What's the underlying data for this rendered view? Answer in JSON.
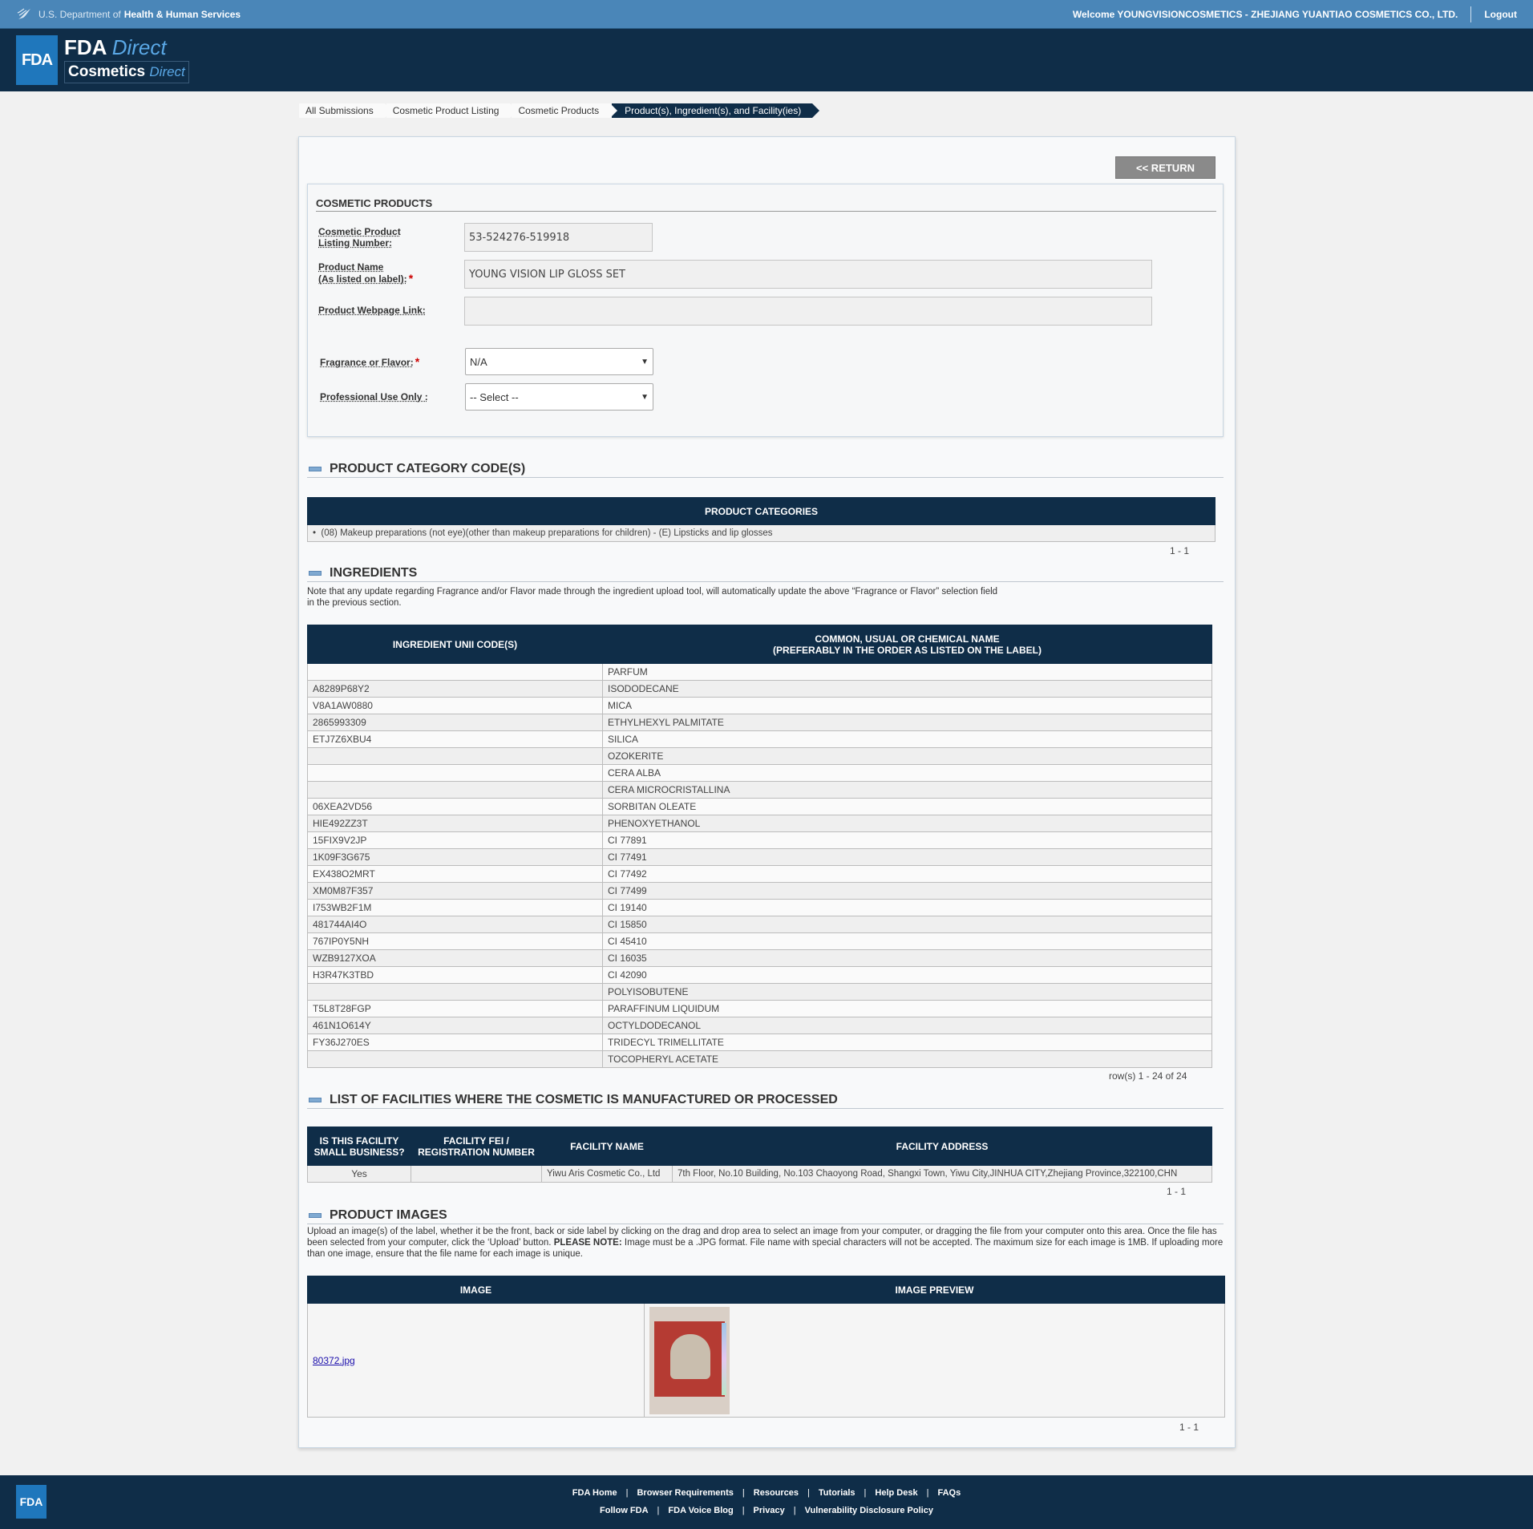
{
  "topbar": {
    "dept_prefix": "U.S. Department of",
    "dept_name": "Health & Human Services",
    "welcome": "Welcome YOUNGVISIONCOSMETICS - ZHEJIANG YUANTIAO COSMETICS CO., LTD.",
    "logout": "Logout"
  },
  "header": {
    "badge": "FDA",
    "brand_bold": "FDA",
    "brand_italic": "Direct",
    "brand2_bold": "Cosmetics",
    "brand2_italic": "Direct"
  },
  "breadcrumb": [
    "All Submissions",
    "Cosmetic Product Listing",
    "Cosmetic Products",
    "Product(s), Ingredient(s), and Facility(ies)"
  ],
  "return_button": "<< RETURN",
  "cosmetic_products": {
    "title": "COSMETIC PRODUCTS",
    "listing_number_label_1": "Cosmetic Product",
    "listing_number_label_2": "Listing Number:",
    "listing_number": "53-524276-519918",
    "product_name_label_1": "Product Name",
    "product_name_label_2": "(As listed on label):",
    "product_name": "YOUNG VISION LIP GLOSS SET",
    "webpage_label": "Product Webpage Link:",
    "webpage_value": "",
    "fragrance_label": "Fragrance or Flavor:",
    "fragrance_value": "N/A",
    "professional_label": "Professional Use Only :",
    "professional_value": "-- Select --",
    "required_mark": "*"
  },
  "category_section": {
    "title": "PRODUCT CATEGORY CODE(S)",
    "column": "PRODUCT CATEGORIES",
    "items": [
      "(08) Makeup preparations (not eye)(other than makeup preparations for children) - (E) Lipsticks and lip glosses"
    ],
    "pager": "1 - 1"
  },
  "ingredients_section": {
    "title": "INGREDIENTS",
    "note_1": "Note that any update regarding Fragrance and/or Flavor made through the ingredient upload tool, will automatically update the above “Fragrance or Flavor” selection field",
    "note_2": "in the previous section.",
    "col1": "INGREDIENT UNII CODE(S)",
    "col2_line1": "COMMON, USUAL OR CHEMICAL NAME",
    "col2_line2": "(PREFERABLY IN THE ORDER AS LISTED ON THE LABEL)",
    "rows": [
      [
        "",
        "PARFUM"
      ],
      [
        "A8289P68Y2",
        "ISODODECANE"
      ],
      [
        "V8A1AW0880",
        "MICA"
      ],
      [
        "2865993309",
        "ETHYLHEXYL PALMITATE"
      ],
      [
        "ETJ7Z6XBU4",
        "SILICA"
      ],
      [
        "",
        "OZOKERITE"
      ],
      [
        "",
        "CERA ALBA"
      ],
      [
        "",
        "CERA MICROCRISTALLINA"
      ],
      [
        "06XEA2VD56",
        "SORBITAN OLEATE"
      ],
      [
        "HIE492ZZ3T",
        "PHENOXYETHANOL"
      ],
      [
        "15FIX9V2JP",
        "CI 77891"
      ],
      [
        "1K09F3G675",
        "CI 77491"
      ],
      [
        "EX438O2MRT",
        "CI 77492"
      ],
      [
        "XM0M87F357",
        "CI 77499"
      ],
      [
        "I753WB2F1M",
        "CI 19140"
      ],
      [
        "481744AI4O",
        "CI 15850"
      ],
      [
        "767IP0Y5NH",
        "CI 45410"
      ],
      [
        "WZB9127XOA",
        "CI 16035"
      ],
      [
        "H3R47K3TBD",
        "CI 42090"
      ],
      [
        "",
        "POLYISOBUTENE"
      ],
      [
        "T5L8T28FGP",
        "PARAFFINUM LIQUIDUM"
      ],
      [
        "461N1O614Y",
        "OCTYLDODECANOL"
      ],
      [
        "FY36J270ES",
        "TRIDECYL TRIMELLITATE"
      ],
      [
        "",
        "TOCOPHERYL ACETATE"
      ]
    ],
    "pager": "row(s) 1 - 24 of 24"
  },
  "facilities_section": {
    "title": "LIST OF FACILITIES WHERE THE COSMETIC IS MANUFACTURED OR PROCESSED",
    "col1_line1": "IS THIS FACILITY",
    "col1_line2": "SMALL BUSINESS?",
    "col2_line1": "FACILITY FEI /",
    "col2_line2": "REGISTRATION NUMBER",
    "col3": "FACILITY NAME",
    "col4": "FACILITY ADDRESS",
    "rows": [
      [
        "Yes",
        "",
        "Yiwu Aris Cosmetic Co., Ltd",
        "7th Floor, No.10 Building, No.103 Chaoyong Road, Shangxi Town, Yiwu City,JINHUA CITY,Zhejiang Province,322100,CHN"
      ]
    ],
    "pager": "1 - 1"
  },
  "images_section": {
    "title": "PRODUCT IMAGES",
    "note_a": "Upload an image(s) of the label, whether it be the front, back or side label by clicking on the drag and drop area to select an image from your computer, or dragging the file from your computer onto this area. Once the file has been selected from your computer, click the ‘Upload’ button.",
    "note_strong": "PLEASE NOTE:",
    "note_b": "Image must be a .JPG format. File name with special characters will not be accepted. The maximum size for each image is 1MB. If uploading more than one image, ensure that the file name for each image is unique.",
    "col1": "IMAGE",
    "col2": "IMAGE PREVIEW",
    "file_name": "80372.jpg",
    "pager": "1 - 1"
  },
  "footer": {
    "badge": "FDA",
    "row1": [
      "FDA Home",
      "Browser Requirements",
      "Resources",
      "Tutorials",
      "Help Desk",
      "FAQs"
    ],
    "row2": [
      "Follow FDA",
      "FDA Voice Blog",
      "Privacy",
      "Vulnerability Disclosure Policy"
    ]
  }
}
